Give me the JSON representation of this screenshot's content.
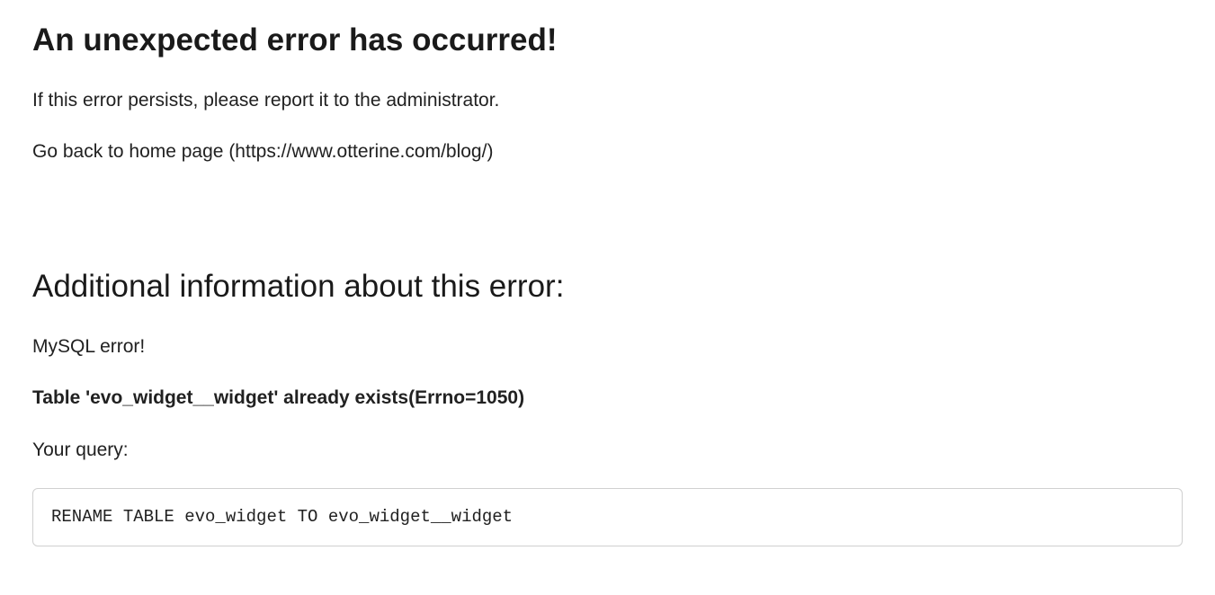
{
  "error": {
    "title": "An unexpected error has occurred!",
    "persist_message": "If this error persists, please report it to the administrator.",
    "go_back_prefix": "Go back to ",
    "go_back_link_text": "home page",
    "go_back_url_display": " (https://www.otterine.com/blog/)"
  },
  "additional": {
    "heading": "Additional information about this error:",
    "db_error_label": "MySQL error!",
    "db_error_detail": "Table 'evo_widget__widget' already exists(Errno=1050)",
    "query_label": "Your query:",
    "query_text": "RENAME TABLE evo_widget TO evo_widget__widget"
  }
}
